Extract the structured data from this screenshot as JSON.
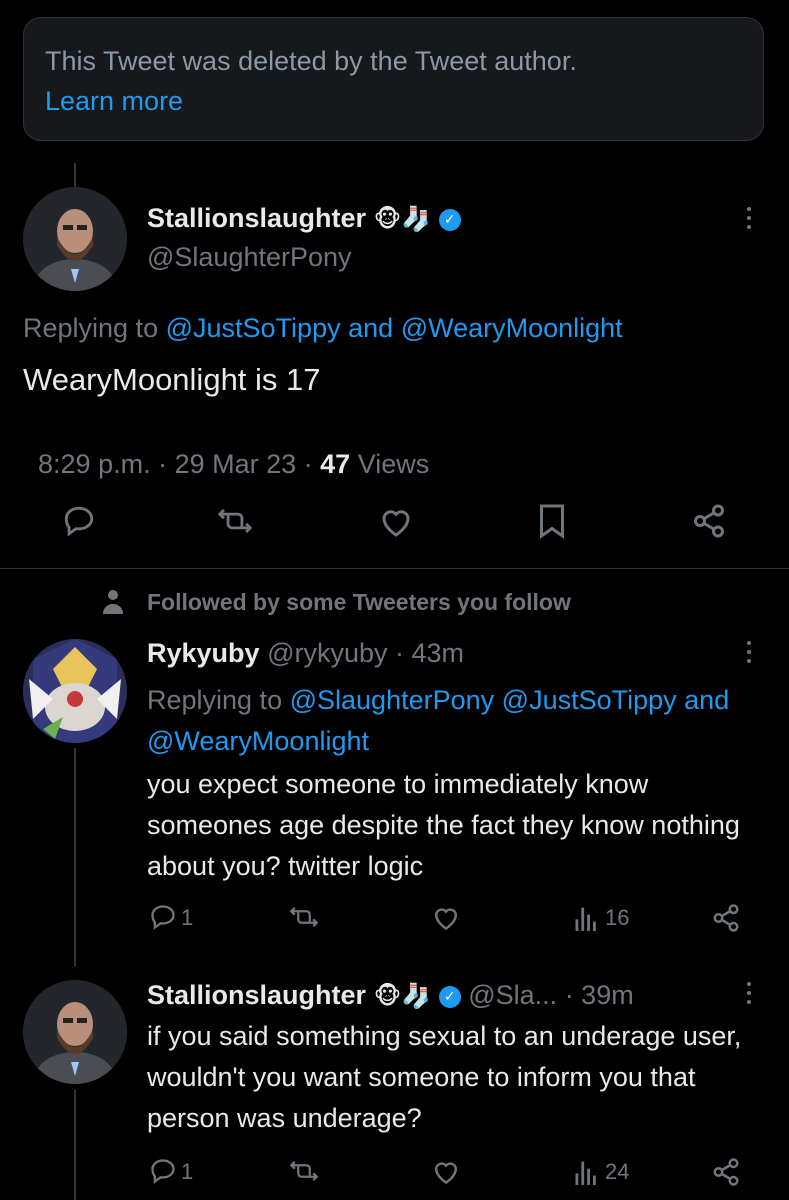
{
  "deleted_notice": {
    "text": "This Tweet was deleted by the Tweet author.",
    "link": "Learn more"
  },
  "main_tweet": {
    "display_name": "Stallionslaughter",
    "emojis": "🐵🧦",
    "handle": "@SlaughterPony",
    "reply_prefix": "Replying to",
    "reply_mention_1": "@JustSoTippy",
    "reply_and": "and",
    "reply_mention_2": "@WearyMoonlight",
    "text": "WearyMoonlight is 17",
    "time": "8:29 p.m. · 29 Mar 23 · ",
    "views_count": "47",
    "views_label": " Views"
  },
  "social_context": "Followed by some Tweeters you follow",
  "reply1": {
    "display_name": "Rykyuby",
    "handle_time": "@rykyuby · 43m",
    "reply_prefix": "Replying to",
    "mention_1": "@SlaughterPony",
    "mention_2": "@JustSoTippy",
    "reply_and": "and",
    "mention_3": "@WearyMoonlight",
    "text": "you expect someone to immediately know someones age despite the fact they know nothing about you? twitter logic",
    "reply_count": "1",
    "views_count": "16"
  },
  "reply2": {
    "display_name": "Stallionslaughter",
    "emojis": "🐵🧦",
    "handle": "@Sla...",
    "time": "· 39m",
    "text": "if you said something sexual to an underage user, wouldn't you want someone to inform you that person was underage?",
    "reply_count": "1",
    "views_count": "24"
  },
  "colors": {
    "accent": "#1d9bf0",
    "muted": "#71767b",
    "background": "#000000",
    "notice_bg": "#16181c"
  },
  "icons": [
    "reply-icon",
    "retweet-icon",
    "like-icon",
    "bookmark-icon",
    "share-icon",
    "views-icon",
    "more-icon",
    "person-icon",
    "verified-icon"
  ]
}
